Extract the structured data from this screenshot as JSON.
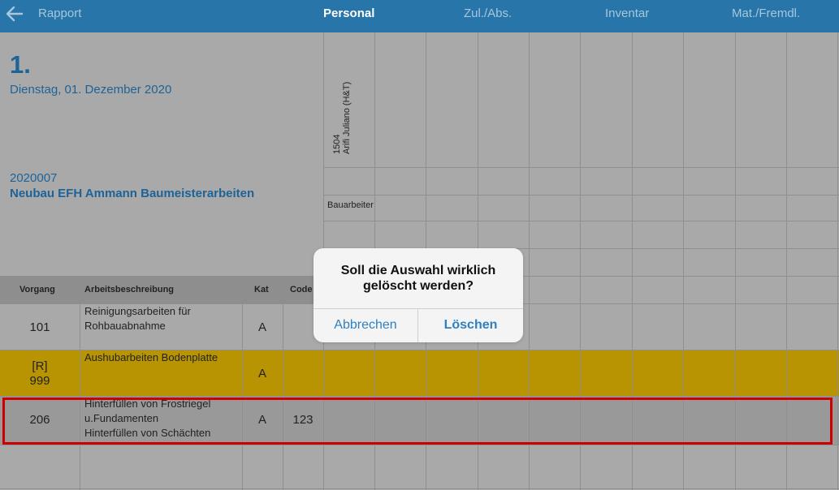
{
  "nav": {
    "back_label": "Rapport",
    "tabs": [
      {
        "label": "Personal",
        "active": true
      },
      {
        "label": "Zul./Abs.",
        "active": false
      },
      {
        "label": "Inventar",
        "active": false
      },
      {
        "label": "Mat./Fremdl.",
        "active": false
      }
    ]
  },
  "report": {
    "day": "1.",
    "date": "Dienstag, 01. Dezember 2020",
    "project_number": "2020007",
    "project_name": "Neubau EFH Ammann Baumeisterarbeiten"
  },
  "employee": {
    "number": "1504",
    "name": "Arifi Juliano (H&T)",
    "role": "Bauarbeiter"
  },
  "table": {
    "headers": {
      "vorgang": "Vorgang",
      "beschreibung": "Arbeitsbeschreibung",
      "kat": "Kat",
      "code": "Code"
    },
    "rows": [
      {
        "vorgang": "101",
        "desc_lines": [
          "Reinigungsarbeiten für",
          "Rohbauabnahme"
        ],
        "kat": "A",
        "code": ""
      },
      {
        "vorgang_prefix": "[R]",
        "vorgang": "999",
        "desc_lines": [
          "Aushubarbeiten Bodenplatte"
        ],
        "kat": "A",
        "code": ""
      },
      {
        "vorgang": "206",
        "desc_lines": [
          "Hinterfüllen von Frostriegel",
          "u.Fundamenten",
          "Hinterfüllen von Schächten"
        ],
        "kat": "A",
        "code": "123"
      }
    ]
  },
  "dialog": {
    "message_line1": "Soll die Auswahl wirklich",
    "message_line2": "gelöscht werden?",
    "cancel_label": "Abbrechen",
    "delete_label": "Löschen"
  },
  "colors": {
    "nav_bar": "#2775a9",
    "accent_text": "#1d6398",
    "highlight_row": "#b99402",
    "selection_border": "#cc0000"
  }
}
